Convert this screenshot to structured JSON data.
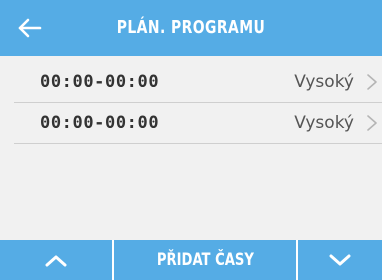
{
  "header": {
    "title": "PLÁN. PROGRAMU",
    "back_icon": "arrow-left-icon"
  },
  "schedule": [
    {
      "time": "00:00-00:00",
      "level": "Vysoký"
    },
    {
      "time": "00:00-00:00",
      "level": "Vysoký"
    }
  ],
  "footer": {
    "up_icon": "chevron-up-icon",
    "add_label": "PŘIDAT ČASY",
    "down_icon": "chevron-down-icon"
  },
  "colors": {
    "accent": "#55ace5",
    "background": "#f1f1f1"
  }
}
